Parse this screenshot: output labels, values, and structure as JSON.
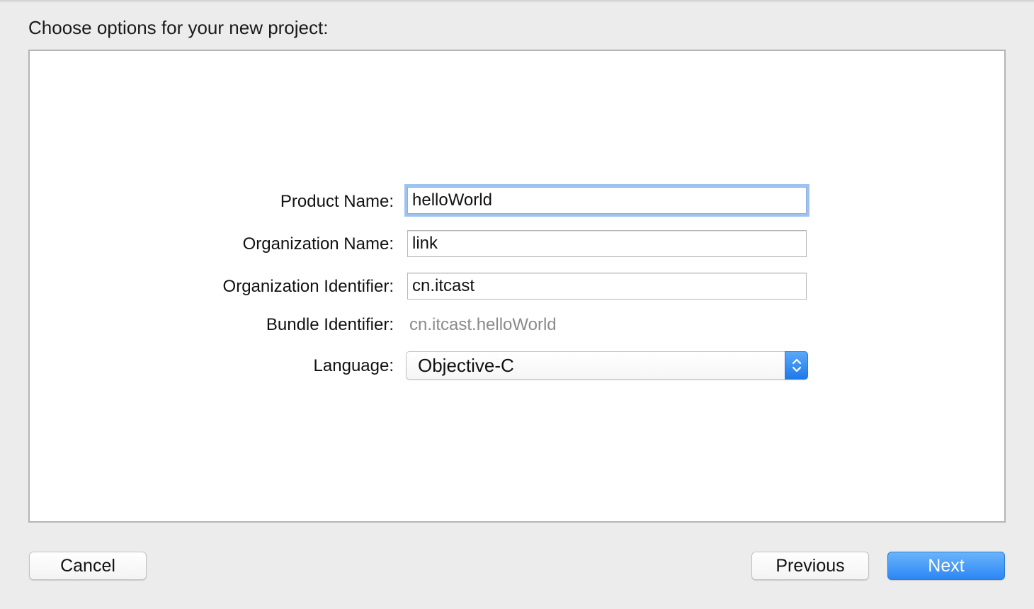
{
  "heading": "Choose options for your new project:",
  "form": {
    "product_name_label": "Product Name:",
    "product_name_value": "helloWorld",
    "org_name_label": "Organization Name:",
    "org_name_value": "link",
    "org_identifier_label": "Organization Identifier:",
    "org_identifier_value": "cn.itcast",
    "bundle_identifier_label": "Bundle Identifier:",
    "bundle_identifier_value": "cn.itcast.helloWorld",
    "language_label": "Language:",
    "language_value": "Objective-C"
  },
  "buttons": {
    "cancel": "Cancel",
    "previous": "Previous",
    "next": "Next"
  },
  "colors": {
    "accent": "#2b86f5",
    "focus_ring": "#9ec3f0",
    "muted_text": "#8a8a8a"
  },
  "icons": {
    "language_select": "up-down-chevron-icon"
  }
}
